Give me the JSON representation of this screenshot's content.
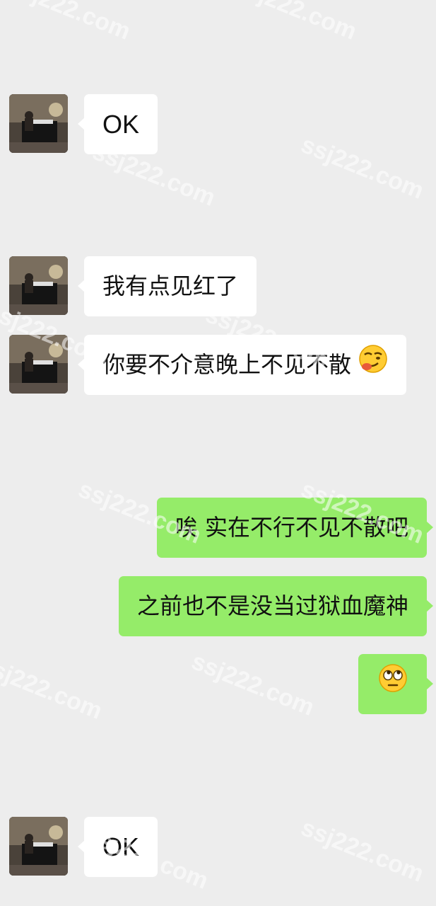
{
  "messages": [
    {
      "side": "in",
      "text": "OK"
    },
    {
      "side": "in",
      "text": "我有点见红了"
    },
    {
      "side": "in",
      "text": "你要不介意晚上不见不散",
      "emoji": "smirking-face-emoji"
    },
    {
      "side": "out",
      "text": "唉 实在不行不见不散吧"
    },
    {
      "side": "out",
      "text": "之前也不是没当过狱血魔神"
    },
    {
      "side": "out",
      "text": "",
      "emoji": "face-with-rolling-eyes-emoji"
    },
    {
      "side": "in",
      "text": "OK"
    }
  ],
  "watermark": "ssj222.com",
  "colors": {
    "background": "#ededed",
    "incoming_bubble": "#ffffff",
    "outgoing_bubble": "#95ec69"
  }
}
